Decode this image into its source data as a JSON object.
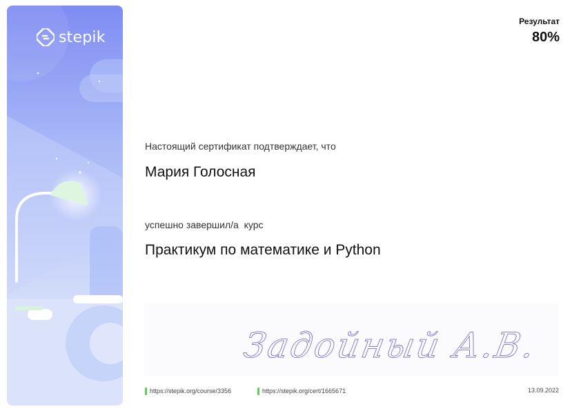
{
  "brand": {
    "name": "stepik",
    "icon": "stepik-logo-icon"
  },
  "result": {
    "label": "Результат",
    "value": "80%"
  },
  "certificate": {
    "intro": "Настоящий сертификат подтверждает, что",
    "student_name": "Мария Голосная",
    "completed_text": "успешно завершил/а  курс",
    "course_title": "Практикум по математике и Python"
  },
  "signature": {
    "text": "Задойный А.В.",
    "color": "#7b72c9"
  },
  "footer": {
    "course_link": "https://stepik.org/course/3356",
    "cert_link": "https://stepik.org/cert/1665671",
    "date": "13.09.2022",
    "link_marker_color": "#5fcc5f"
  },
  "colors": {
    "sidebar_top": "#7f8df3",
    "sidebar_bottom": "#e4ebfb",
    "accent_green": "#dff5e0"
  }
}
